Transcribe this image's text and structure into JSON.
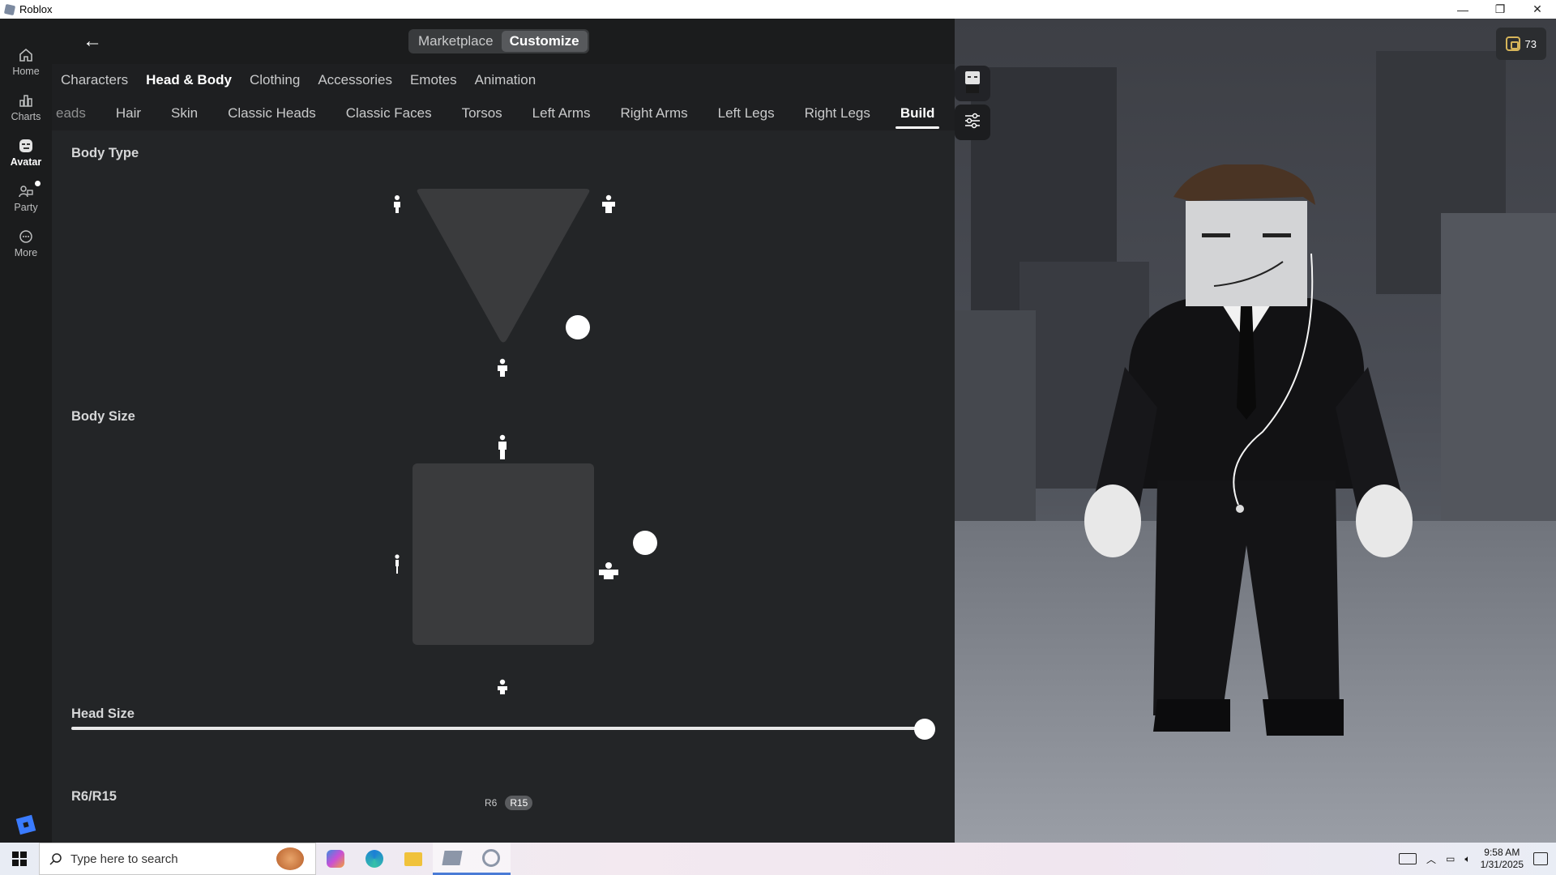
{
  "window": {
    "title": "Roblox",
    "minimize": "—",
    "restore": "❐",
    "close": "✕"
  },
  "nav": {
    "items": [
      {
        "label": "Home",
        "icon": "home-icon"
      },
      {
        "label": "Charts",
        "icon": "charts-icon"
      },
      {
        "label": "Avatar",
        "icon": "avatar-icon",
        "active": true
      },
      {
        "label": "Party",
        "icon": "party-icon"
      },
      {
        "label": "More",
        "icon": "more-icon"
      }
    ]
  },
  "topbar": {
    "back": "←",
    "modes": [
      "Marketplace",
      "Customize"
    ],
    "active_mode": "Customize"
  },
  "categories": [
    "Characters",
    "Head & Body",
    "Clothing",
    "Accessories",
    "Emotes",
    "Animation"
  ],
  "active_category": "Head & Body",
  "subcategories": [
    "eads",
    "Hair",
    "Skin",
    "Classic Heads",
    "Classic Faces",
    "Torsos",
    "Left Arms",
    "Right Arms",
    "Left Legs",
    "Right Legs",
    "Build"
  ],
  "active_subcategory": "Build",
  "build": {
    "body_type_label": "Body Type",
    "body_size_label": "Body Size",
    "head_size_label": "Head Size",
    "head_size_value": 1.0,
    "rig_label": "R6/R15",
    "rig_options": [
      "R6",
      "R15"
    ],
    "rig_selected": "R15"
  },
  "wallet": {
    "robux": "73"
  },
  "taskbar": {
    "search_placeholder": "Type here to search",
    "time": "9:58 AM",
    "date": "1/31/2025"
  },
  "colors": {
    "accent": "#3a7bff",
    "panel": "#232527",
    "nav": "#1b1c1d"
  }
}
